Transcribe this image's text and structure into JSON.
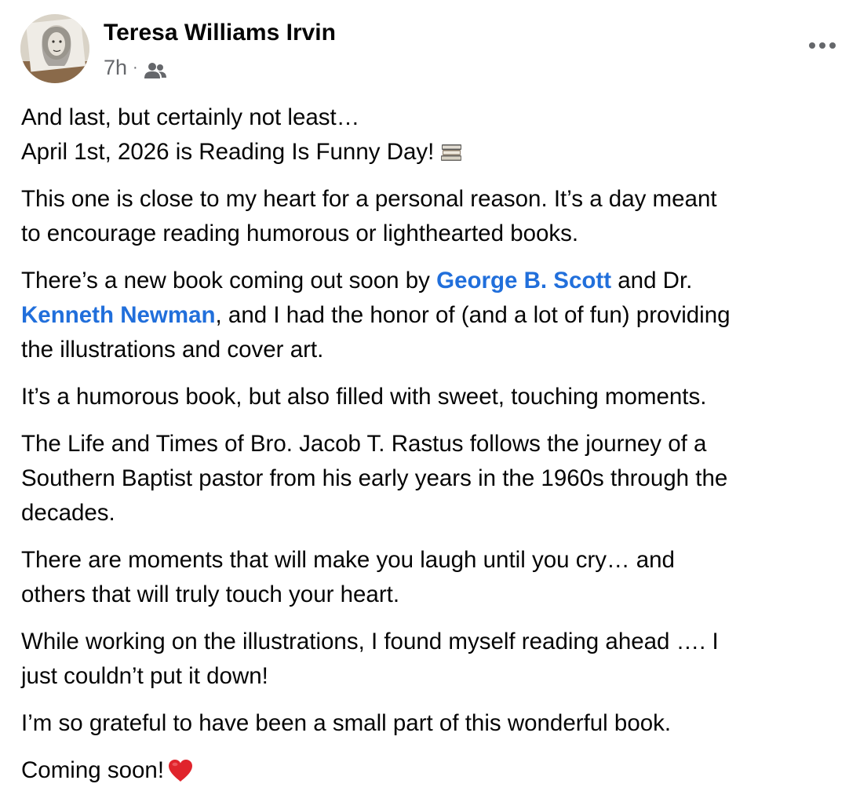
{
  "post": {
    "author": {
      "name": "Teresa Williams Irvin",
      "avatar_icon": "profile-photo"
    },
    "timestamp": "7h",
    "separator": "·",
    "audience_icon": "friends-icon",
    "more_icon": "more-options-icon",
    "body": {
      "p1_line1": "And last, but certainly not least…",
      "p1_line2": "April 1st, 2026 is Reading Is Funny Day!",
      "p1_emoji": "books-emoji",
      "p2_line1": "This one is close to my heart for a personal reason. It’s a day meant",
      "p2_line2": "to encourage reading humorous or lighthearted books.",
      "p3_line1_before": "There’s a new book coming out soon by ",
      "p3_mention1": "George B. Scott",
      "p3_line1_after": " and Dr.",
      "p3_mention2": "Kenneth Newman",
      "p3_line2_after": ", and I had the honor of (and a lot of fun) providing",
      "p3_line3": "the illustrations and cover art.",
      "p4_line1": "It’s a humorous book, but also filled with sweet, touching moments.",
      "p5_line1": "The Life and Times of Bro. Jacob T. Rastus follows the journey of a",
      "p5_line2": "Southern Baptist pastor from his early years in the 1960s through the",
      "p5_line3": "decades.",
      "p6_line1": "There are moments that will make you laugh until you cry… and",
      "p6_line2": "others that will truly touch your heart.",
      "p7_line1": "While working on the illustrations, I found myself reading ahead …. I",
      "p7_line2": "just couldn’t put it down!",
      "p8_line1": "I’m so grateful to have been a small part of this wonderful book.",
      "p9_line1": "Coming soon!",
      "p9_emoji": "red-heart-emoji"
    }
  },
  "colors": {
    "text": "#050505",
    "secondary_text": "#65676b",
    "mention_link": "#216fdb",
    "background": "#ffffff"
  }
}
